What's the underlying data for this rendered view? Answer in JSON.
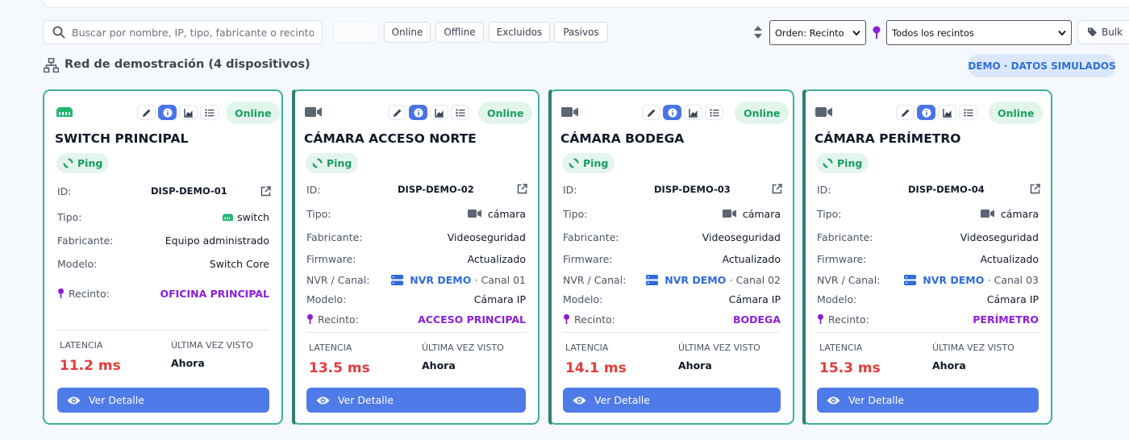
{
  "toolbar": {
    "search_placeholder": "Buscar por nombre, IP, tipo, fabricante o recinto...",
    "filters": [
      "Online",
      "Offline",
      "Excluidos",
      "Pasivos"
    ],
    "sort_label": "Orden: Recinto",
    "venue_label": "Todos los recintos",
    "bulk_label": "Bulk"
  },
  "section": {
    "title": "Red de demostración (4 dispositivos)",
    "demo_badge": "DEMO · DATOS SIMULADOS"
  },
  "labels": {
    "id": "ID:",
    "type": "Tipo:",
    "manufacturer": "Fabricante:",
    "model": "Modelo:",
    "firmware": "Firmware:",
    "nvr": "NVR / Canal:",
    "venue": "Recinto:",
    "latency": "LATENCIA",
    "last_seen": "ÚLTIMA VEZ VISTO",
    "detail_button": "Ver Detalle",
    "ping": "Ping",
    "status": "Online"
  },
  "colors": {
    "accent": "#4f7be8",
    "online": "#18a05e",
    "latency": "#e33b3b",
    "venue": "#8a1fd6",
    "card_border": "#3eb09a"
  },
  "devices": [
    {
      "icon": "switch-icon",
      "name": "SWITCH PRINCIPAL",
      "id": "DISP-DEMO-01",
      "type": "switch",
      "manufacturer": "Equipo administrado",
      "model": "Switch Core",
      "venue": "OFICINA PRINCIPAL",
      "latency": "11.2 ms",
      "last_seen": "Ahora"
    },
    {
      "icon": "camera-icon",
      "name": "CÁMARA ACCESO NORTE",
      "id": "DISP-DEMO-02",
      "type": "cámara",
      "manufacturer": "Videoseguridad",
      "firmware": "Actualizado",
      "nvr": "NVR DEMO",
      "channel": "· Canal 01",
      "model": "Cámara IP",
      "venue": "ACCESO PRINCIPAL",
      "latency": "13.5 ms",
      "last_seen": "Ahora"
    },
    {
      "icon": "camera-icon",
      "name": "CÁMARA BODEGA",
      "id": "DISP-DEMO-03",
      "type": "cámara",
      "manufacturer": "Videoseguridad",
      "firmware": "Actualizado",
      "nvr": "NVR DEMO",
      "channel": "· Canal 02",
      "model": "Cámara IP",
      "venue": "BODEGA",
      "latency": "14.1 ms",
      "last_seen": "Ahora"
    },
    {
      "icon": "camera-icon",
      "name": "CÁMARA PERÍMETRO",
      "id": "DISP-DEMO-04",
      "type": "cámara",
      "manufacturer": "Videoseguridad",
      "firmware": "Actualizado",
      "nvr": "NVR DEMO",
      "channel": "· Canal 03",
      "model": "Cámara IP",
      "venue": "PERÍMETRO",
      "latency": "15.3 ms",
      "last_seen": "Ahora"
    }
  ]
}
